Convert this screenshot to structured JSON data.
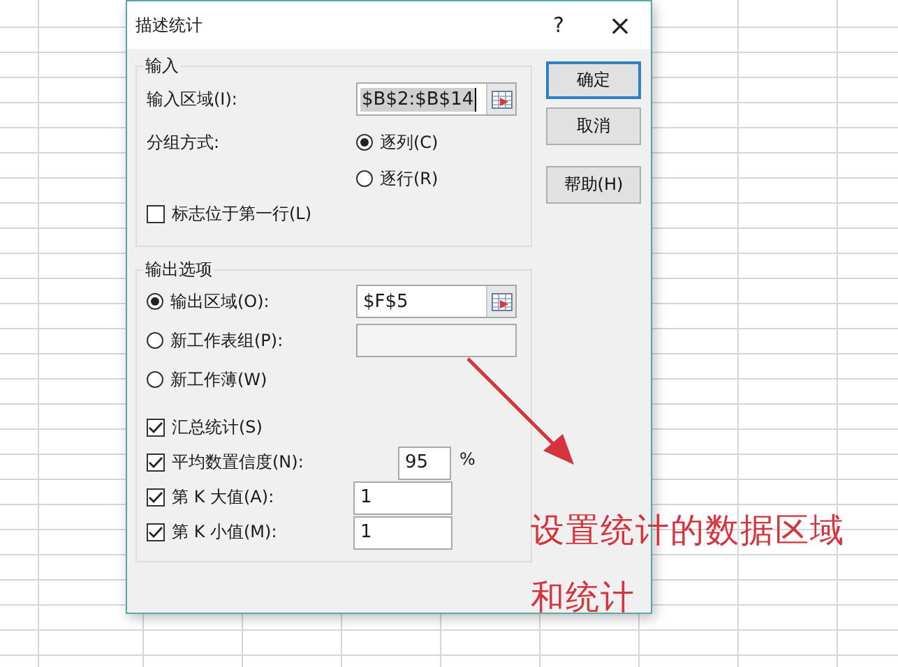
{
  "window": {
    "title": "描述统计",
    "help": "?",
    "close": "×"
  },
  "input_group": {
    "title": "输入",
    "range_label": "输入区域(I):",
    "range_value": "$B$2:$B$14",
    "group_label": "分组方式:",
    "grouping": [
      {
        "label": "逐列(C)",
        "selected": true
      },
      {
        "label": "逐行(R)",
        "selected": false
      }
    ],
    "labels_first_row": {
      "label": "标志位于第一行(L)",
      "checked": false
    }
  },
  "output_group": {
    "title": "输出选项",
    "destinations": [
      {
        "kind": "range",
        "label": "输出区域(O):",
        "selected": true,
        "value": "$F$5"
      },
      {
        "kind": "field",
        "label": "新工作表组(P):",
        "selected": false,
        "disabled": true
      },
      {
        "kind": "none",
        "label": "新工作薄(W)",
        "selected": false
      }
    ],
    "options": [
      {
        "kind": "plain",
        "label": "汇总统计(S)",
        "checked": true
      },
      {
        "kind": "percent",
        "label": "平均数置信度(N):",
        "checked": true,
        "value": "95",
        "unit": "%"
      },
      {
        "kind": "number",
        "label": "第 K 大值(A):",
        "checked": true,
        "value": "1"
      },
      {
        "kind": "number",
        "label": "第 K 小值(M):",
        "checked": true,
        "value": "1"
      }
    ]
  },
  "buttons": [
    {
      "label": "确定",
      "default": true
    },
    {
      "label": "取消",
      "default": false
    },
    {
      "label": "帮助(H)",
      "default": false
    }
  ],
  "annotation": {
    "lines": [
      "设置统计的数据区域",
      "和统计"
    ]
  }
}
